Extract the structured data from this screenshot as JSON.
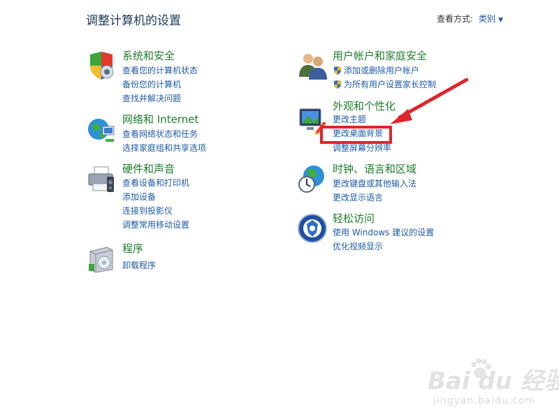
{
  "header": {
    "title": "调整计算机的设置",
    "view_label": "查看方式:",
    "view_value": "类别"
  },
  "categories": {
    "system": {
      "title": "系统和安全",
      "links": [
        "查看您的计算机状态",
        "备份您的计算机",
        "查找并解决问题"
      ]
    },
    "network": {
      "title": "网络和 Internet",
      "links": [
        "查看网络状态和任务",
        "选择家庭组和共享选项"
      ]
    },
    "hardware": {
      "title": "硬件和声音",
      "links": [
        "查看设备和打印机",
        "添加设备",
        "连接到投影仪",
        "调整常用移动设置"
      ]
    },
    "programs": {
      "title": "程序",
      "links": [
        "卸载程序"
      ]
    },
    "users": {
      "title": "用户帐户和家庭安全",
      "links": [
        "添加或删除用户帐户",
        "为所有用户设置家长控制"
      ]
    },
    "appearance": {
      "title": "外观和个性化",
      "links": [
        "更改主题",
        "更改桌面背景",
        "调整屏幕分辨率"
      ]
    },
    "clock": {
      "title": "时钟、语言和区域",
      "links": [
        "更改键盘或其他输入法",
        "更改显示语言"
      ]
    },
    "access": {
      "title": "轻松访问",
      "links": [
        "使用 Windows 建议的设置",
        "优化视频显示"
      ]
    }
  },
  "watermark": {
    "main": "Bai du 经验",
    "sub": "jingyan.baidu.com"
  },
  "colors": {
    "category_title": "#1d7d2c",
    "link": "#1e5aa8",
    "annotation": "#e0252b"
  }
}
